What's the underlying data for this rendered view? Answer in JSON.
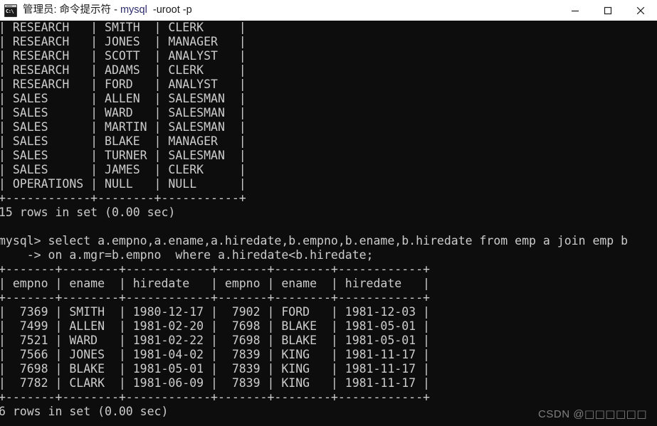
{
  "window": {
    "title_prefix": "管理员: 命令提示符 - ",
    "title_highlight": "mysql",
    "title_suffix": "  -uroot -p",
    "icon_name": "cmd-console-icon",
    "icon_glyph": "C:\\",
    "controls": {
      "minimize_label": "Minimize",
      "maximize_label": "Maximize",
      "close_label": "Close"
    }
  },
  "console": {
    "background": "#0d0d0d",
    "foreground": "#cccccc",
    "lines": [
      "| RESEARCH   | SMITH  | CLERK     |",
      "| RESEARCH   | JONES  | MANAGER   |",
      "| RESEARCH   | SCOTT  | ANALYST   |",
      "| RESEARCH   | ADAMS  | CLERK     |",
      "| RESEARCH   | FORD   | ANALYST   |",
      "| SALES      | ALLEN  | SALESMAN  |",
      "| SALES      | WARD   | SALESMAN  |",
      "| SALES      | MARTIN | SALESMAN  |",
      "| SALES      | BLAKE  | MANAGER   |",
      "| SALES      | TURNER | SALESMAN  |",
      "| SALES      | JAMES  | CLERK     |",
      "| OPERATIONS | NULL   | NULL      |",
      "+------------+--------+-----------+",
      "15 rows in set (0.00 sec)",
      "",
      "mysql> select a.empno,a.ename,a.hiredate,b.empno,b.ename,b.hiredate from emp a join emp b",
      "    -> on a.mgr=b.empno  where a.hiredate<b.hiredate;",
      "+-------+--------+------------+-------+--------+------------+",
      "| empno | ename  | hiredate   | empno | ename  | hiredate   |",
      "+-------+--------+------------+-------+--------+------------+",
      "|  7369 | SMITH  | 1980-12-17 |  7902 | FORD   | 1981-12-03 |",
      "|  7499 | ALLEN  | 1981-02-20 |  7698 | BLAKE  | 1981-05-01 |",
      "|  7521 | WARD   | 1981-02-22 |  7698 | BLAKE  | 1981-05-01 |",
      "|  7566 | JONES  | 1981-04-02 |  7839 | KING   | 1981-11-17 |",
      "|  7698 | BLAKE  | 1981-05-01 |  7839 | KING   | 1981-11-17 |",
      "|  7782 | CLARK  | 1981-06-09 |  7839 | KING   | 1981-11-17 |",
      "+-------+--------+------------+-------+--------+------------+",
      "6 rows in set (0.00 sec)"
    ]
  },
  "watermark": {
    "brand": "CSDN @",
    "username": "□□□□□□"
  }
}
